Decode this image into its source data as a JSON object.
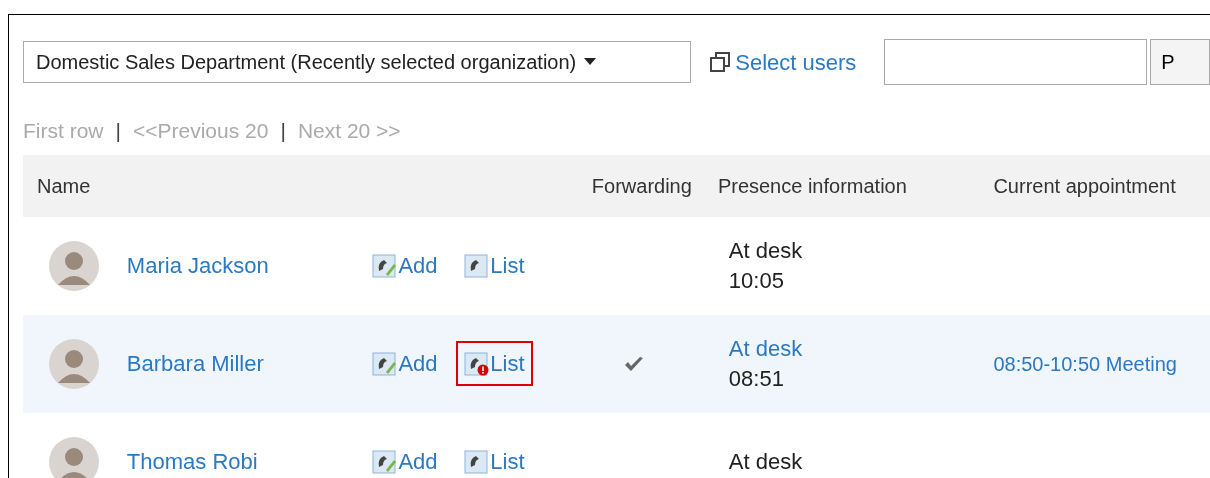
{
  "organization_select": {
    "value": "Domestic Sales Department (Recently selected organization)"
  },
  "select_users_link": "Select users",
  "search": {
    "button": "P"
  },
  "pagination": {
    "separator": "|",
    "links": [
      "First row",
      "<<Previous 20",
      "Next 20 >>"
    ]
  },
  "table": {
    "columns": [
      "Name",
      "",
      "Forwarding",
      "Presence information",
      "Current appointment"
    ],
    "rows": [
      {
        "name": "Maria Jackson",
        "add": "Add",
        "list": "List",
        "list_alert": false,
        "list_framed": false,
        "forwarding": false,
        "presence": "At desk",
        "presence_link": false,
        "time": "10:05",
        "appointment": "",
        "hovered": false
      },
      {
        "name": "Barbara Miller",
        "add": "Add",
        "list": "List",
        "list_alert": true,
        "list_framed": true,
        "forwarding": true,
        "presence": "At desk",
        "presence_link": true,
        "time": "08:51",
        "appointment": "08:50-10:50 Meeting",
        "hovered": true
      },
      {
        "name": "Thomas Robi",
        "add": "Add",
        "list": "List",
        "list_alert": false,
        "list_framed": false,
        "forwarding": false,
        "presence": "At desk",
        "presence_link": false,
        "time": "",
        "appointment": "",
        "hovered": false
      }
    ]
  }
}
